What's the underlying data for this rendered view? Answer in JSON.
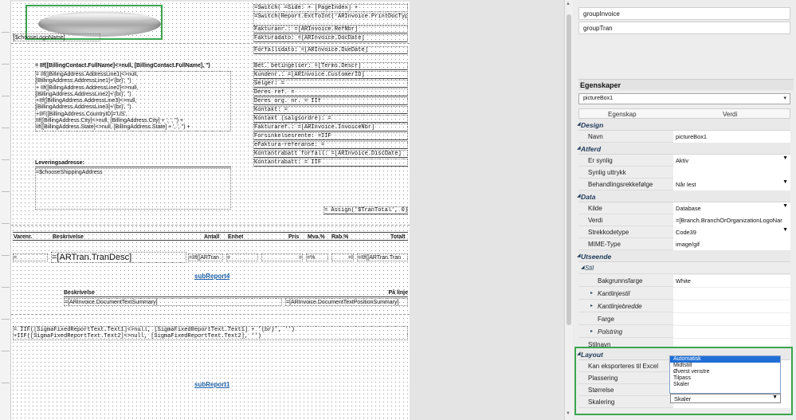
{
  "groups": [
    "groupInvoice",
    "groupTran"
  ],
  "properties_panel": {
    "title": "Egenskaper",
    "selected_object": "pictureBox1",
    "col_property": "Egenskap",
    "col_value": "Verdi"
  },
  "property_rows": [
    {
      "type": "cat",
      "label": "Design"
    },
    {
      "label": "Navn",
      "value": "pictureBox1"
    },
    {
      "type": "cat",
      "label": "Atferd"
    },
    {
      "label": "Er synlig",
      "value": "Aktiv",
      "dropdown": true
    },
    {
      "label": "Synlig uttrykk",
      "value": ""
    },
    {
      "label": "Behandlingsrekkefølge",
      "value": "Når lest",
      "dropdown": true
    },
    {
      "type": "cat",
      "label": "Data"
    },
    {
      "label": "Kilde",
      "value": "Database",
      "dropdown": true
    },
    {
      "label": "Verdi",
      "value": "=[Branch.BranchOrOrganizationLogoNar"
    },
    {
      "label": "Strekkodetype",
      "value": "Code39",
      "dropdown": true
    },
    {
      "label": "MIME-Type",
      "value": "image/gif"
    },
    {
      "type": "cat",
      "label": "Utseende"
    },
    {
      "type": "sub",
      "label": "Stil"
    },
    {
      "label": "Bakgrunnsfarge",
      "value": "White",
      "indent": true
    },
    {
      "label": "Kantlinjestil",
      "value": "",
      "expandable": true
    },
    {
      "label": "Kantlinjebredde",
      "value": "",
      "expandable": true
    },
    {
      "label": "Farge",
      "value": "",
      "indent": true
    },
    {
      "label": "Polstring",
      "value": "",
      "expandable": true
    },
    {
      "label": "Stilnavn",
      "value": ""
    },
    {
      "type": "cat",
      "label": "Layout"
    },
    {
      "label": "Kan eksporteres til Excel",
      "value": ""
    },
    {
      "label": "Plassering",
      "value": ""
    },
    {
      "label": "Størrelse",
      "value": ""
    },
    {
      "label": "Skalering",
      "value": ""
    }
  ],
  "layout_dropdown": {
    "options": [
      "Automatisk",
      "Midtstill",
      "Øverst venstre",
      "Tilpass",
      "Skaler"
    ],
    "selected_index": 0,
    "current": "Skaler"
  },
  "designer": {
    "picture_field": "[$chooseLogoName]",
    "header_fields": [
      "=Switch(                =Side:  + [PageIndex] +",
      "=Switch(Report.ExtToInt('ARInvoice.PrintDocType",
      "Fakturanr.:          =[ARInvoice.RefNbr]",
      "Fakturadato:        =[ARInvoice.DocDate]",
      "Forfallsdato:       =[ARInvoice.DueDate]"
    ],
    "billing_name": "= IIf([BillingContact.FullName]<>null,     [BillingContact.FullName], '')",
    "billing_address": "= IIf([BillingAddress.AddressLine1]<>null,\n[BillingAddress.AddressLine1]+'{br}', '')\n+ IIf([BillingAddress.AddressLine2]<>null,\n[BillingAddress.AddressLine2]+'{br}', '')\n+IIf([BillingAddress.AddressLine3]<>null,\n[BillingAddress.AddressLine3]+'{br}', '')\n+IIF([BillingAddress.CountryID]='US',\n   IIf([BillingAddress.City]<>null, [BillingAddress.City] + ', ', '') +\nIIf([BillingAddress.State]<>null, [BillingAddress.State] + ', ', '') +",
    "info_fields": [
      "Bet. betingelser:          =[Terms.Descr]",
      "Kundenr.:          =[ARInvoice.CustomerID]",
      "Selger:                                    =",
      "Deres ref.                                 =",
      "Deres org. nr.                          = IIf",
      "Kontakt:                                   =",
      "Kontakt (salgsordre):                 =",
      "Fakturaref.:       =[ARInvoice.InvoiceNbr]",
      "Forsinkelsesrente:                     =IIF",
      "eFaktura-referanse:                  =",
      "Kontantrabatt forfall:  =[ARInvoice.DiscDate]",
      "Kontantrabatt:                       = IIF"
    ],
    "delivery_title": "Leveringsadresse:",
    "delivery_value": "=$chooseShippingAddress",
    "assign": "= Assign('$TranTotal', 0)",
    "table_headers": [
      "Varenr.",
      "Beskrivelse",
      "Antall",
      "Enhet",
      "Pris",
      "Mva.%",
      "Rab.%",
      "Totalt"
    ],
    "detail_cells": [
      "=",
      "=[ARTran.TranDesc]",
      "=IIf([ARTran",
      "=",
      "=",
      "=%",
      "=I",
      "=IIf([ARTran.Tran"
    ],
    "subreport4": "subReport4",
    "summary_header_left": "Beskrivelse",
    "summary_header_right": "På linje",
    "summary_left": "=[ARInvoice.DocumentTextSummary]",
    "summary_right": "=[ARInvoice.DocumentTextPositionSummary]",
    "footer_text": "= IIF([SigmaFixedReportText.Text1]<>null, [SigmaFixedReportText.Text1] + '{br}', '')\n +IIF([SigmaFixedReportText.Text2]<>null, [SigmaFixedReportText.Text2], '')",
    "subreport1": "subReport1"
  }
}
